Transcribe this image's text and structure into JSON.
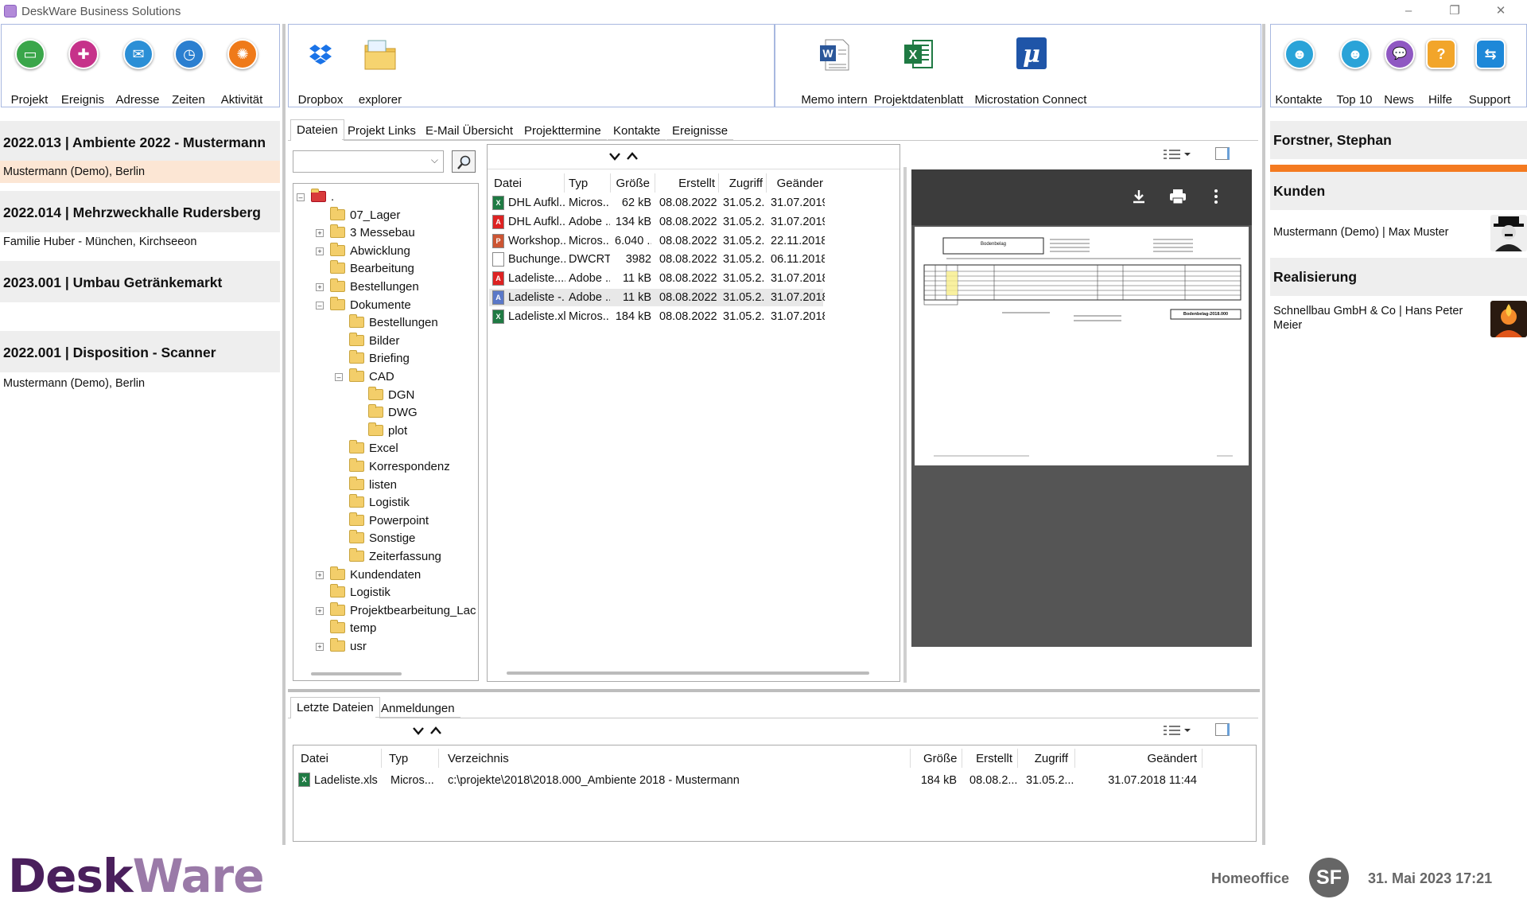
{
  "window": {
    "title": "DeskWare Business Solutions",
    "minimize": "–",
    "maximize": "❐",
    "close": "✕"
  },
  "ribbon": {
    "group1": [
      {
        "label": "Projekt",
        "icon": "folder-icon",
        "color": "#3aa64a",
        "glyph": "▭"
      },
      {
        "label": "Ereignis",
        "icon": "puzzle-icon",
        "color": "#c6328a",
        "glyph": "✚"
      },
      {
        "label": "Adresse",
        "icon": "mail-icon",
        "color": "#2b8fd6",
        "glyph": "✉"
      },
      {
        "label": "Zeiten",
        "icon": "stopwatch-icon",
        "color": "#2b7fd0",
        "glyph": "◷"
      },
      {
        "label": "Aktivität",
        "icon": "activity-icon",
        "color": "#ef7a1a",
        "glyph": "✺"
      }
    ],
    "group2": [
      {
        "label": "Dropbox",
        "icon": "dropbox-icon"
      },
      {
        "label": "explorer",
        "icon": "explorer-folder-icon"
      }
    ],
    "group3": [
      {
        "label": "Memo intern",
        "icon": "word-document-icon"
      },
      {
        "label": "Projektdatenblatt",
        "icon": "excel-icon"
      },
      {
        "label": "Microstation Connect",
        "icon": "microstation-icon"
      }
    ],
    "group4": [
      {
        "label": "Kontakte",
        "icon": "contacts-icon",
        "color": "#2aa3d8",
        "glyph": "☻"
      },
      {
        "label": "Top 10",
        "icon": "top10-icon",
        "color": "#2aa3d8",
        "glyph": "☻"
      },
      {
        "label": "News",
        "icon": "news-icon",
        "color": "#8f58c2",
        "glyph": "💬"
      },
      {
        "label": "Hilfe",
        "icon": "help-icon",
        "color": "#f2a52a",
        "glyph": "?"
      },
      {
        "label": "Support",
        "icon": "support-icon",
        "color": "#1e88d8",
        "glyph": "⇆"
      }
    ]
  },
  "projects": [
    {
      "title": "2022.013 |  Ambiente 2022 - Mustermann",
      "sub": "Mustermann (Demo), Berlin"
    },
    {
      "title": "2022.014 |  Mehrzweckhalle Rudersberg",
      "sub": "Familie Huber - München, Kirchseeon"
    },
    {
      "title": "2023.001 |  Umbau Getränkemarkt",
      "sub": ""
    },
    {
      "title": "2022.001 |  Disposition - Scanner",
      "sub": "Mustermann (Demo), Berlin"
    }
  ],
  "tabs": [
    "Dateien",
    "Projekt Links",
    "E-Mail Übersicht",
    "Projekttermine",
    "Kontakte",
    "Ereignisse"
  ],
  "tree": [
    {
      "label": ".",
      "level": 0,
      "exp": "–",
      "root": true
    },
    {
      "label": "07_Lager",
      "level": 1,
      "exp": ""
    },
    {
      "label": "3 Messebau",
      "level": 1,
      "exp": "+"
    },
    {
      "label": "Abwicklung",
      "level": 1,
      "exp": "+"
    },
    {
      "label": "Bearbeitung",
      "level": 1,
      "exp": ""
    },
    {
      "label": "Bestellungen",
      "level": 1,
      "exp": "+"
    },
    {
      "label": "Dokumente",
      "level": 1,
      "exp": "–"
    },
    {
      "label": "Bestellungen",
      "level": 2,
      "exp": ""
    },
    {
      "label": "Bilder",
      "level": 2,
      "exp": ""
    },
    {
      "label": "Briefing",
      "level": 2,
      "exp": ""
    },
    {
      "label": "CAD",
      "level": 2,
      "exp": "–"
    },
    {
      "label": "DGN",
      "level": 3,
      "exp": ""
    },
    {
      "label": "DWG",
      "level": 3,
      "exp": ""
    },
    {
      "label": "plot",
      "level": 3,
      "exp": ""
    },
    {
      "label": "Excel",
      "level": 2,
      "exp": ""
    },
    {
      "label": "Korrespondenz",
      "level": 2,
      "exp": ""
    },
    {
      "label": "listen",
      "level": 2,
      "exp": ""
    },
    {
      "label": "Logistik",
      "level": 2,
      "exp": ""
    },
    {
      "label": "Powerpoint",
      "level": 2,
      "exp": ""
    },
    {
      "label": "Sonstige",
      "level": 2,
      "exp": ""
    },
    {
      "label": "Zeiterfassung",
      "level": 2,
      "exp": ""
    },
    {
      "label": "Kundendaten",
      "level": 1,
      "exp": "+"
    },
    {
      "label": "Logistik",
      "level": 1,
      "exp": ""
    },
    {
      "label": "Projektbearbeitung_Lac",
      "level": 1,
      "exp": "+"
    },
    {
      "label": "temp",
      "level": 1,
      "exp": ""
    },
    {
      "label": "usr",
      "level": 1,
      "exp": "+"
    }
  ],
  "files": {
    "columns": [
      "Datei",
      "Typ",
      "Größe",
      "Erstellt",
      "Zugriff",
      "Geänder"
    ],
    "rows": [
      {
        "name": "DHL Aufkl...",
        "type": "Micros...",
        "size": "62 kB",
        "created": "08.08.2022 ...",
        "access": "31.05.2...",
        "changed": "31.07.2019 .",
        "icon": "excel-file-icon",
        "ic": "X",
        "col": "#1f7a43"
      },
      {
        "name": "DHL Aufkl...",
        "type": "Adobe ...",
        "size": "134 kB",
        "created": "08.08.2022 ...",
        "access": "31.05.2...",
        "changed": "31.07.2019 .",
        "icon": "pdf-file-icon",
        "ic": "A",
        "col": "#d22"
      },
      {
        "name": "Workshop...",
        "type": "Micros...",
        "size": "6.040 ...",
        "created": "08.08.2022 ...",
        "access": "31.05.2...",
        "changed": "22.11.2018 .",
        "icon": "powerpoint-file-icon",
        "ic": "P",
        "col": "#c53"
      },
      {
        "name": "Buchunge...",
        "type": "DWCRT...",
        "size": "3982",
        "created": "08.08.2022 ...",
        "access": "31.05.2...",
        "changed": "06.11.2018 .",
        "icon": "generic-file-icon",
        "ic": "",
        "col": "#fff"
      },
      {
        "name": "Ladeliste....",
        "type": "Adobe ...",
        "size": "11 kB",
        "created": "08.08.2022 ...",
        "access": "31.05.2...",
        "changed": "31.07.2018 .",
        "icon": "pdf-file-icon",
        "ic": "A",
        "col": "#d22"
      },
      {
        "name": "Ladeliste -...",
        "type": "Adobe ...",
        "size": "11 kB",
        "created": "08.08.2022 ...",
        "access": "31.05.2...",
        "changed": "31.07.2018 .",
        "icon": "pdf-file-icon",
        "ic": "A",
        "col": "#5a78c8",
        "selected": true
      },
      {
        "name": "Ladeliste.xls",
        "type": "Micros...",
        "size": "184 kB",
        "created": "08.08.2022 ...",
        "access": "31.05.2...",
        "changed": "31.07.2018 .",
        "icon": "excel-file-icon",
        "ic": "X",
        "col": "#1f7a43"
      }
    ]
  },
  "preview": {
    "doc_title": "Bodenbelag",
    "stamp": "Bodenbelag-2018.000"
  },
  "bottom_tabs": [
    "Letzte Dateien",
    "Anmeldungen"
  ],
  "recent": {
    "columns": [
      "Datei",
      "Typ",
      "Verzeichnis",
      "Größe",
      "Erstellt",
      "Zugriff",
      "Geändert"
    ],
    "rows": [
      {
        "name": "Ladeliste.xls",
        "type": "Micros...",
        "dir": "c:\\projekte\\2018\\2018.000_Ambiente 2018 - Mustermann",
        "size": "184 kB",
        "created": "08.08.2...",
        "access": "31.05.2...",
        "changed": "31.07.2018 11:44"
      }
    ]
  },
  "right": {
    "user": "Forstner, Stephan",
    "sections": [
      {
        "title": "Kunden",
        "entry": "Mustermann (Demo) | Max Muster"
      },
      {
        "title": "Realisierung",
        "entry": "Schnellbau GmbH & Co | Hans Peter Meier"
      }
    ]
  },
  "footer": {
    "logo_a": "Desk",
    "logo_b": "Ware",
    "location": "Homeoffice",
    "initials": "SF",
    "datetime": "31. Mai 2023 17:21"
  },
  "colors": {
    "accent_orange": "#f47a20",
    "panel_border": "#a8b8e0",
    "logo_purple": "#4a1f5c"
  }
}
